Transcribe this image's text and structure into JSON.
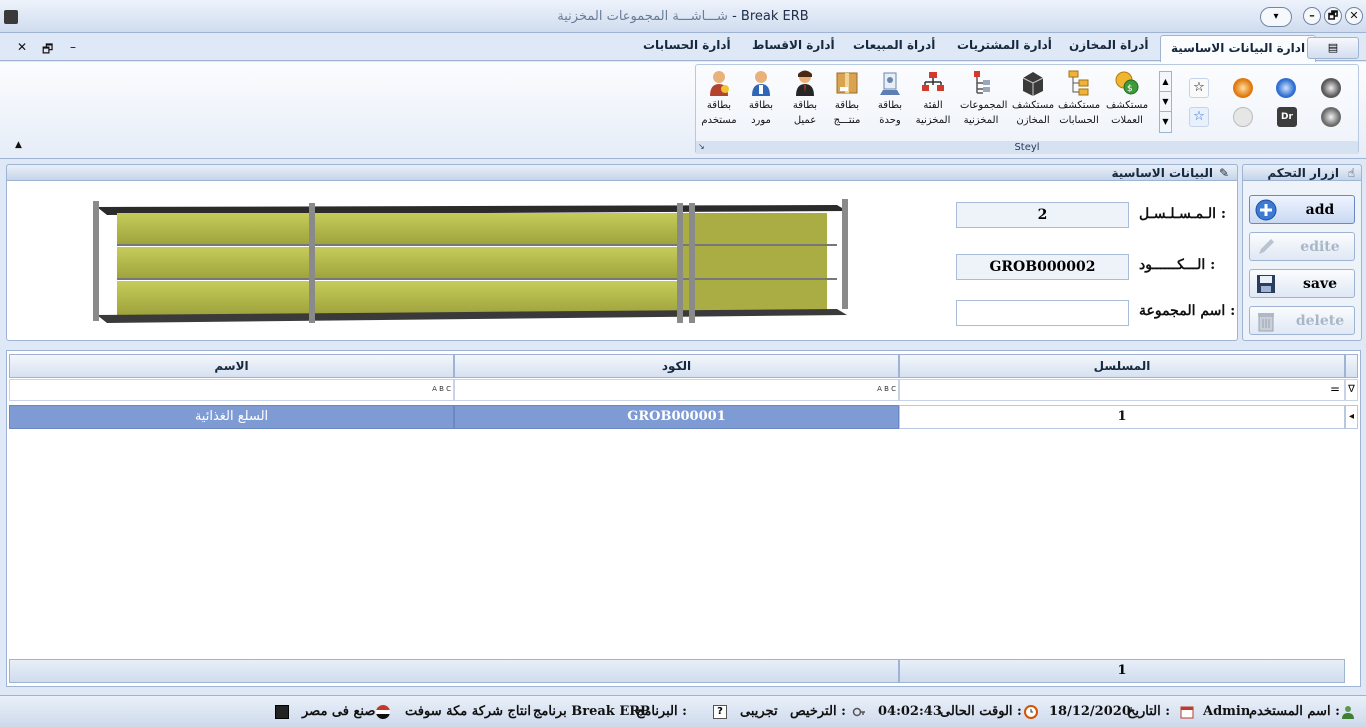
{
  "window": {
    "title_arabic": "شـــاشـــة المجموعات المخزنية",
    "title_sep": " - ",
    "title_app": "Break ERB",
    "minimize_glyph": "–",
    "restore_glyph": "🗗",
    "close_glyph": "✕",
    "quick_access_glyph": "▾"
  },
  "menu": {
    "app_button_glyph": "▤",
    "tabs": [
      {
        "label": "ادارة البيانات الاساسية"
      },
      {
        "label": "أدراة المخازن"
      },
      {
        "label": "أدارة المشتريات"
      },
      {
        "label": "أدراة المبيعات"
      },
      {
        "label": "أدارة الاقساط"
      },
      {
        "label": "أدارة الحسابات"
      }
    ],
    "mdi_controls": {
      "close": "✕",
      "restore": "🗗",
      "minimize": "–"
    }
  },
  "ribbon": {
    "group_caption": "Steyl",
    "launcher_glyph": "↘",
    "collapse_glyph": "▲",
    "buttons": [
      {
        "line1": "مستكشف",
        "line2": "العملات",
        "icon": "currency-icon"
      },
      {
        "line1": "مستكشف",
        "line2": "الحسابات",
        "icon": "accounts-tree-icon"
      },
      {
        "line1": "مستكشف",
        "line2": "المخازن",
        "icon": "warehouse-icon"
      },
      {
        "line1": "المجموعات",
        "line2": "المخزنية",
        "icon": "groups-icon"
      },
      {
        "line1": "الفئة",
        "line2": "المخزنية",
        "icon": "category-icon"
      },
      {
        "line1": "بطاقة",
        "line2": "وحدة",
        "icon": "unit-icon"
      },
      {
        "line1": "بطاقة",
        "line2": "منتـــج",
        "icon": "product-icon"
      },
      {
        "line1": "بطاقة",
        "line2": "عميل",
        "icon": "customer-icon"
      },
      {
        "line1": "بطاقة",
        "line2": "مورد",
        "icon": "supplier-icon"
      },
      {
        "line1": "بطاقة",
        "line2": "مستخدم",
        "icon": "user-icon"
      }
    ],
    "gallery": {
      "scroll_up": "▲",
      "scroll_down": "▼",
      "scroll_more": "▼",
      "items": [
        {
          "label": "",
          "color": "#5a5a5a"
        },
        {
          "label": "",
          "color": "#2f6fd0"
        },
        {
          "label": "",
          "color": "#e07a10"
        },
        {
          "label": "☆",
          "color": "#fafafa"
        },
        {
          "label": "",
          "color": "#6b6b6b"
        },
        {
          "label": "Dr",
          "color": "#3c3c3c"
        },
        {
          "label": "",
          "color": "#e6e6e6"
        },
        {
          "label": "☆",
          "color": "#e8f0fb"
        }
      ]
    }
  },
  "controls_panel": {
    "title": "ازرار التحكم",
    "buttons": [
      {
        "label": "add",
        "enabled": true,
        "icon": "add-icon"
      },
      {
        "label": "edite",
        "enabled": false,
        "icon": "edit-icon"
      },
      {
        "label": "save",
        "enabled": true,
        "icon": "save-icon"
      },
      {
        "label": "delete",
        "enabled": false,
        "icon": "delete-icon"
      }
    ]
  },
  "basic_data": {
    "title": "البيانات الاساسية",
    "fields": {
      "serial": {
        "label": "الـمـسـلـسـل :",
        "value": "2"
      },
      "code": {
        "label": "الـــكــــــود :",
        "value": "GROB000002"
      },
      "group_name": {
        "label": "اسم المجموعة :",
        "value": ""
      }
    }
  },
  "grid": {
    "columns": [
      "المسلسل",
      "الكود",
      "الاسم"
    ],
    "filter": {
      "equals_glyph": "=",
      "abc_glyph": "A B C",
      "funnel_glyph": "∇"
    },
    "rows": [
      {
        "serial": "1",
        "code": "GROB000001",
        "name": "السلع الغذائية"
      }
    ],
    "row_indicator": "◂",
    "footer_count": "1"
  },
  "statusbar": {
    "user_label": "اسم المستخدم :",
    "user_value": "Admin",
    "date_label": "التاريخ :",
    "date_value": "18/12/2020",
    "time_label": "الوقت الحالى :",
    "time_value": "04:02:43",
    "license_label": "الترخيص :",
    "license_value": "تجريبى",
    "program_label": "البرنامج :",
    "program_value": "برنامج Break ERP",
    "company_text": "انتاج شركة مكة سوفت",
    "made_in_text": "صنع فى مصر"
  }
}
